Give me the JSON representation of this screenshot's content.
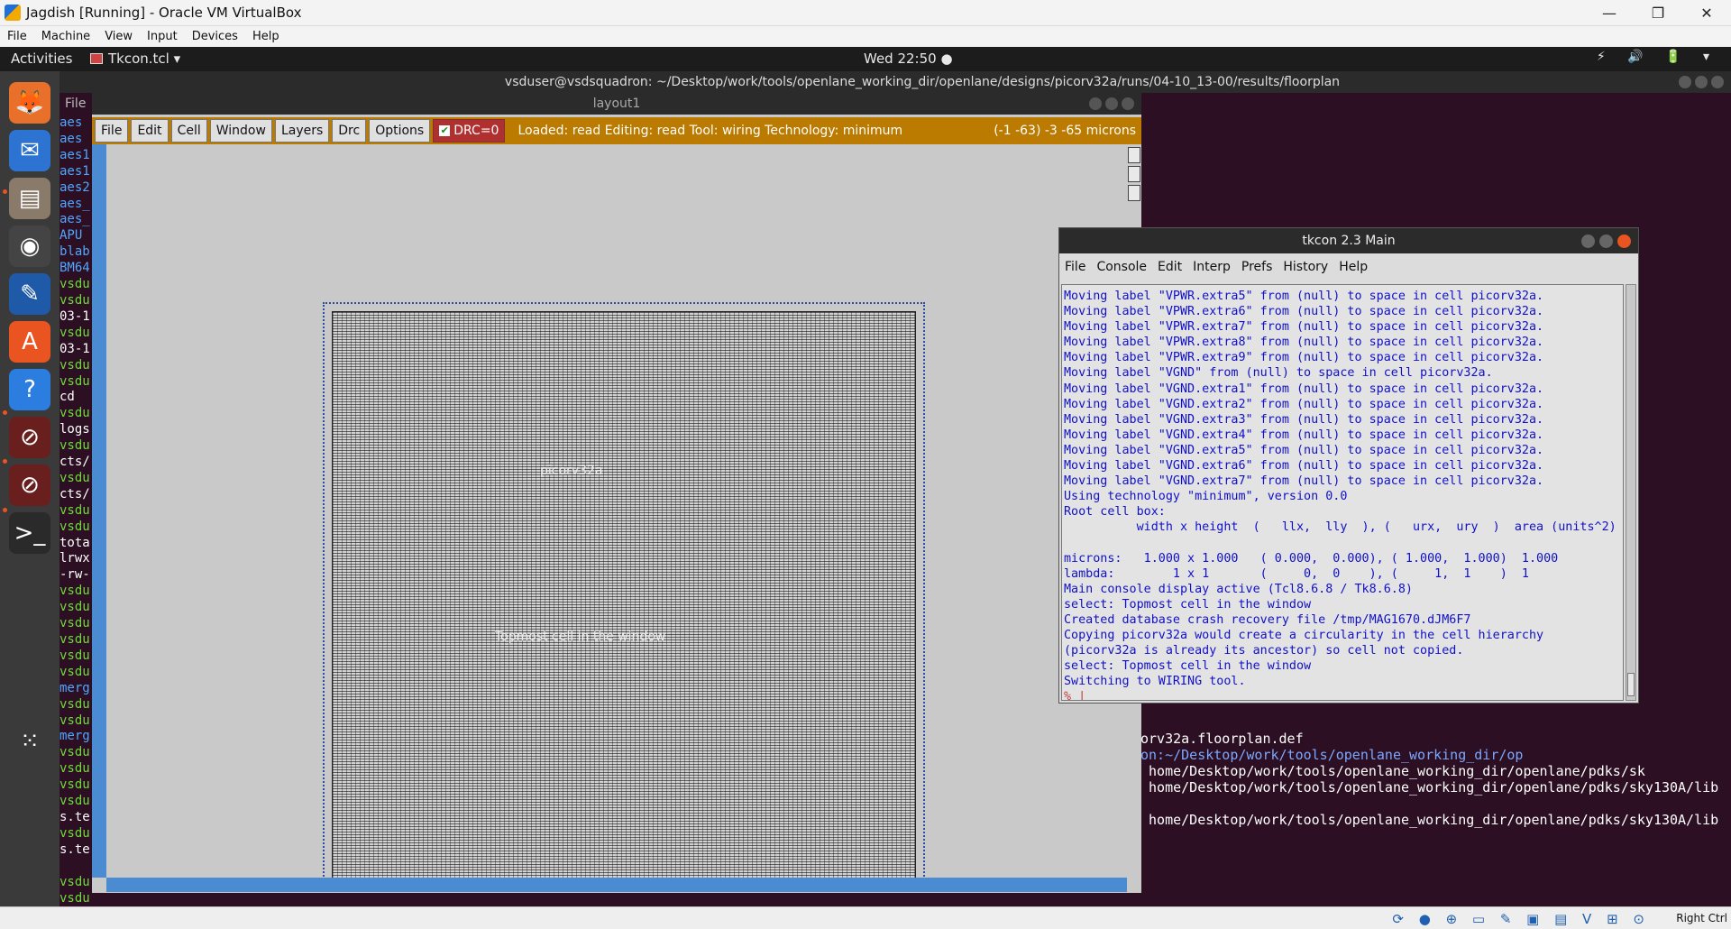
{
  "vbox": {
    "title": "Jagdish [Running] - Oracle VM VirtualBox",
    "menu": [
      "File",
      "Machine",
      "View",
      "Input",
      "Devices",
      "Help"
    ],
    "minimize": "—",
    "restore": "❐",
    "close": "✕",
    "host_key": "Right Ctrl"
  },
  "topbar": {
    "activities": "Activities",
    "app_name": "Tkcon.tcl ▾",
    "clock": "Wed 22:50 ●",
    "tray": "⚡ 🔊 🔋 ▾"
  },
  "terminal": {
    "title": "vsduser@vsdsquadron: ~/Desktop/work/tools/openlane_working_dir/openlane/designs/picorv32a/runs/04-10_13-00/results/floorplan",
    "menu_file": "File",
    "left_lines": [
      {
        "t": "aes",
        "c": "#4fa8ff"
      },
      {
        "t": "aes",
        "c": "#4fa8ff"
      },
      {
        "t": "aes1",
        "c": "#4fa8ff"
      },
      {
        "t": "aes1",
        "c": "#4fa8ff"
      },
      {
        "t": "aes2",
        "c": "#4fa8ff"
      },
      {
        "t": "aes_",
        "c": "#4fa8ff"
      },
      {
        "t": "aes_",
        "c": "#4fa8ff"
      },
      {
        "t": "APU",
        "c": "#4fa8ff"
      },
      {
        "t": "blab",
        "c": "#4fa8ff"
      },
      {
        "t": "BM64",
        "c": "#4fa8ff"
      },
      {
        "t": "vsdu",
        "c": "#6ddb3a"
      },
      {
        "t": "vsdu",
        "c": "#6ddb3a"
      },
      {
        "t": "03-1",
        "c": "#ffffff"
      },
      {
        "t": "vsdu",
        "c": "#6ddb3a"
      },
      {
        "t": "03-1",
        "c": "#ffffff"
      },
      {
        "t": "vsdu",
        "c": "#6ddb3a"
      },
      {
        "t": "vsdu",
        "c": "#6ddb3a"
      },
      {
        "t": "cd",
        "c": "#ffffff"
      },
      {
        "t": "vsdu",
        "c": "#6ddb3a"
      },
      {
        "t": "logs",
        "c": "#ffffff"
      },
      {
        "t": "vsdu",
        "c": "#6ddb3a"
      },
      {
        "t": "cts/",
        "c": "#ffffff"
      },
      {
        "t": "vsdu",
        "c": "#6ddb3a"
      },
      {
        "t": "cts/",
        "c": "#ffffff"
      },
      {
        "t": "vsdu",
        "c": "#6ddb3a"
      },
      {
        "t": "vsdu",
        "c": "#6ddb3a"
      },
      {
        "t": "tota",
        "c": "#ffffff"
      },
      {
        "t": "lrwx",
        "c": "#ffffff"
      },
      {
        "t": "-rw-",
        "c": "#ffffff"
      },
      {
        "t": "vsdu",
        "c": "#6ddb3a"
      },
      {
        "t": "vsdu",
        "c": "#6ddb3a"
      },
      {
        "t": "vsdu",
        "c": "#6ddb3a"
      },
      {
        "t": "vsdu",
        "c": "#6ddb3a"
      },
      {
        "t": "vsdu",
        "c": "#6ddb3a"
      },
      {
        "t": "vsdu",
        "c": "#6ddb3a"
      },
      {
        "t": "merg",
        "c": "#4fa8ff"
      },
      {
        "t": "vsdu",
        "c": "#6ddb3a"
      },
      {
        "t": "vsdu",
        "c": "#6ddb3a"
      },
      {
        "t": "merg",
        "c": "#4fa8ff"
      },
      {
        "t": "vsdu",
        "c": "#6ddb3a"
      },
      {
        "t": "vsdu",
        "c": "#6ddb3a"
      },
      {
        "t": "vsdu",
        "c": "#6ddb3a"
      },
      {
        "t": "vsdu",
        "c": "#6ddb3a"
      },
      {
        "t": "s.te",
        "c": "#ffffff"
      },
      {
        "t": "vsdu",
        "c": "#6ddb3a"
      },
      {
        "t": "s.te",
        "c": "#ffffff"
      },
      {
        "t": "",
        "c": "#ffffff"
      },
      {
        "t": "vsdu",
        "c": "#6ddb3a"
      },
      {
        "t": "vsdu",
        "c": "#6ddb3a"
      }
    ],
    "right_lines": [
      "orv32a.floorplan.def",
      "on:~/Desktop/work/tools/openlane_working_dir/op",
      " home/Desktop/work/tools/openlane_working_dir/openlane/pdks/sk",
      " home/Desktop/work/tools/openlane_working_dir/openlane/pdks/sky130A/lib",
      "",
      " home/Desktop/work/tools/openlane_working_dir/openlane/pdks/sky130A/lib"
    ]
  },
  "layout": {
    "title": "layout1",
    "buttons": [
      "File",
      "Edit",
      "Cell",
      "Window",
      "Layers",
      "Drc",
      "Options"
    ],
    "drc": "DRC=0",
    "status": "Loaded: read Editing: read Tool: wiring  Technology: minimum",
    "coords": "(-1 -63) -3 -65 microns",
    "cell_label_1": "picorv32a",
    "cell_label_2": "Topmost cell in the window"
  },
  "tkcon": {
    "title": "tkcon 2.3 Main",
    "menu": [
      "File",
      "Console",
      "Edit",
      "Interp",
      "Prefs",
      "History",
      "Help"
    ],
    "lines": [
      "Moving label \"VPWR.extra5\" from (null) to space in cell picorv32a.",
      "Moving label \"VPWR.extra6\" from (null) to space in cell picorv32a.",
      "Moving label \"VPWR.extra7\" from (null) to space in cell picorv32a.",
      "Moving label \"VPWR.extra8\" from (null) to space in cell picorv32a.",
      "Moving label \"VPWR.extra9\" from (null) to space in cell picorv32a.",
      "Moving label \"VGND\" from (null) to space in cell picorv32a.",
      "Moving label \"VGND.extra1\" from (null) to space in cell picorv32a.",
      "Moving label \"VGND.extra2\" from (null) to space in cell picorv32a.",
      "Moving label \"VGND.extra3\" from (null) to space in cell picorv32a.",
      "Moving label \"VGND.extra4\" from (null) to space in cell picorv32a.",
      "Moving label \"VGND.extra5\" from (null) to space in cell picorv32a.",
      "Moving label \"VGND.extra6\" from (null) to space in cell picorv32a.",
      "Moving label \"VGND.extra7\" from (null) to space in cell picorv32a.",
      "Using technology \"minimum\", version 0.0",
      "Root cell box:",
      "          width x height  (   llx,  lly  ), (   urx,  ury  )  area (units^2)",
      "",
      "microns:   1.000 x 1.000   ( 0.000,  0.000), ( 1.000,  1.000)  1.000",
      "lambda:        1 x 1       (     0,  0    ), (     1,  1    )  1",
      "Main console display active (Tcl8.6.8 / Tk8.6.8)",
      "select: Topmost cell in the window",
      "Created database crash recovery file /tmp/MAG1670.dJM6F7",
      "Copying picorv32a would create a circularity in the cell hierarchy",
      "(picorv32a is already its ancestor) so cell not copied.",
      "select: Topmost cell in the window",
      "Switching to WIRING tool."
    ],
    "prompt": "% |"
  },
  "dock": [
    "firefox-icon",
    "thunderbird-icon",
    "files-icon",
    "rhythmbox-icon",
    "writer-icon",
    "software-icon",
    "help-icon",
    "app-icon-a",
    "app-icon-b",
    "terminal-icon",
    "show-apps-icon"
  ],
  "dock_glyphs": {
    "firefox-icon": "🦊",
    "thunderbird-icon": "✉",
    "files-icon": "▤",
    "rhythmbox-icon": "◉",
    "writer-icon": "✎",
    "software-icon": "A",
    "help-icon": "?",
    "app-icon-a": "⊘",
    "app-icon-b": "⊘",
    "terminal-icon": ">_",
    "show-apps-icon": "⁙"
  },
  "status_icons": "⟳ ● ⊕ ▭ ✎ ▣ ▤ V ⊞ ⊙"
}
